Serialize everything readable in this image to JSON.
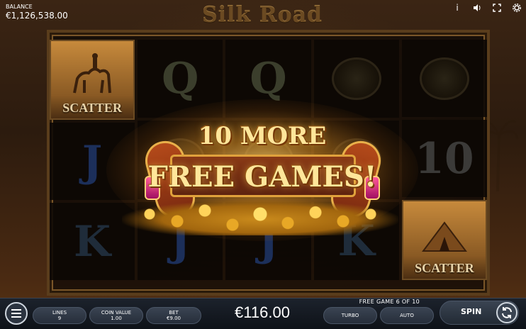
{
  "balance": {
    "label": "BALANCE",
    "value": "€1,126,538.00"
  },
  "logo": {
    "text": "Silk Road"
  },
  "top_icons": [
    "info-icon",
    "sound-icon",
    "fullscreen-icon",
    "settings-icon"
  ],
  "reels": [
    [
      {
        "symbol": "scatter",
        "text": "SCATTER"
      },
      {
        "symbol": "J",
        "text": "J"
      },
      {
        "symbol": "K",
        "text": "K"
      }
    ],
    [
      {
        "symbol": "Q",
        "text": "Q"
      },
      {
        "symbol": "bowl",
        "text": ""
      },
      {
        "symbol": "J",
        "text": "J"
      }
    ],
    [
      {
        "symbol": "Q",
        "text": "Q"
      },
      {
        "symbol": "bowl",
        "text": ""
      },
      {
        "symbol": "J",
        "text": "J"
      }
    ],
    [
      {
        "symbol": "bowl",
        "text": ""
      },
      {
        "symbol": "bowl",
        "text": ""
      },
      {
        "symbol": "K",
        "text": "K"
      }
    ],
    [
      {
        "symbol": "bowl",
        "text": ""
      },
      {
        "symbol": "10",
        "text": "10"
      },
      {
        "symbol": "scatter",
        "text": "SCATTER"
      }
    ]
  ],
  "win_banner": {
    "line1": "10 MORE",
    "line2": "FREE GAMES!"
  },
  "bottom": {
    "free_game_status": "FREE GAME 6 OF 10",
    "lines_label": "LINES",
    "lines_value": "9",
    "coin_value_label": "COIN VALUE",
    "coin_value": "1.00",
    "bet_label": "BET",
    "bet_value": "€9.00",
    "win_amount": "€116.00",
    "turbo_label": "TURBO",
    "auto_label": "AUTO",
    "spin_label": "SPIN"
  },
  "colors": {
    "gold": "#ffe69a",
    "frame": "#5a3d1c",
    "bar": "#1c222c"
  }
}
